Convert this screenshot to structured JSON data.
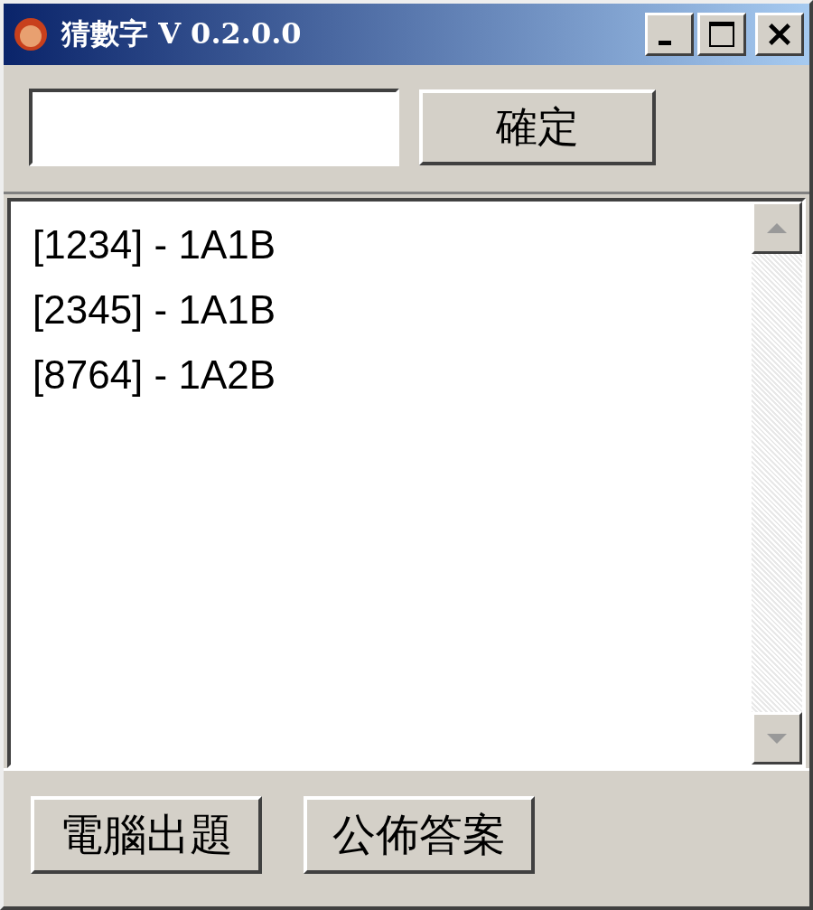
{
  "window": {
    "title": "猜數字 V 0.2.0.0",
    "controls": [
      {
        "kind": "minimize"
      },
      {
        "kind": "maximize"
      },
      {
        "kind": "close"
      }
    ]
  },
  "guess": {
    "button": "確定"
  },
  "history": [
    "[1234] - 1A1B",
    "[2345] - 1A1B",
    "[8764] - 1A2B"
  ],
  "buttons": [
    "電腦出題",
    "公佈答案"
  ]
}
